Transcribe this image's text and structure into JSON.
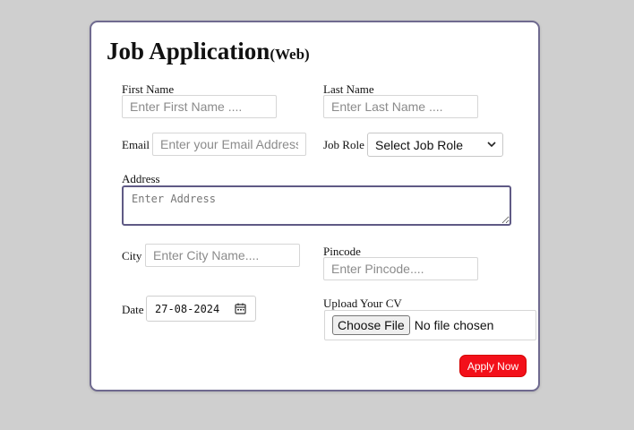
{
  "form": {
    "title": "Job Application",
    "title_suffix": "(Web)",
    "first_name": {
      "label": "First Name",
      "placeholder": "Enter First Name ...."
    },
    "last_name": {
      "label": "Last Name",
      "placeholder": "Enter Last Name ...."
    },
    "email": {
      "label": "Email",
      "placeholder": "Enter your Email Address .."
    },
    "job_role": {
      "label": "Job Role",
      "selected": "Select Job Role"
    },
    "address": {
      "label": "Address",
      "placeholder": "Enter Address"
    },
    "city": {
      "label": "City",
      "placeholder": "Enter City Name...."
    },
    "pincode": {
      "label": "Pincode",
      "placeholder": "Enter Pincode...."
    },
    "date": {
      "label": "Date",
      "value": "27-08-2024"
    },
    "upload": {
      "label": "Upload Your CV",
      "button": "Choose File",
      "status": "No file chosen"
    },
    "submit": "Apply Now"
  },
  "icons": {
    "select_arrow": "chevron-down-icon",
    "date_picker": "calendar-icon"
  },
  "colors": {
    "accent": "#f3101a",
    "card_border": "#6f6a8f",
    "background": "#cfcfcf"
  }
}
